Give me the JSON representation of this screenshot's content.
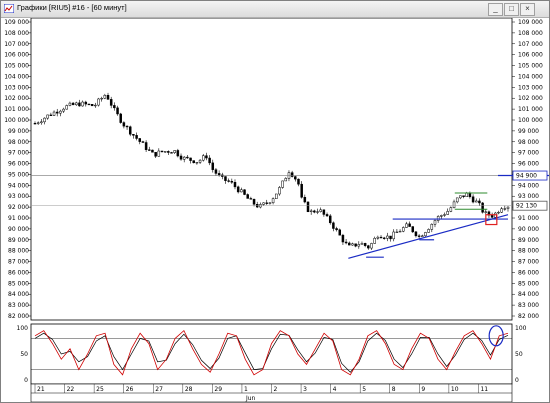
{
  "window": {
    "title": "Графики [RIU5] #16 - [60 минут]",
    "buttons": {
      "minimize": "_",
      "maximize": "□",
      "close": "×"
    }
  },
  "price_axis": {
    "left_labels": [
      "109 000",
      "108 000",
      "107 000",
      "106 000",
      "105 000",
      "104 000",
      "103 000",
      "102 000",
      "101 000",
      "100 000",
      "99 000",
      "98 000",
      "97 000",
      "96 000",
      "95 000",
      "94 000",
      "93 000",
      "92 000",
      "91 000",
      "90 000",
      "89 000",
      "88 000",
      "87 000",
      "86 000",
      "85 000",
      "84 000",
      "83 000",
      "82 000"
    ],
    "right_labels": [
      "109 000",
      "108 000",
      "107 000",
      "106 000",
      "105 000",
      "104 000",
      "103 000",
      "102 000",
      "101 000",
      "100 000",
      "99 000",
      "98 000",
      "97 000",
      "96 000",
      "95 000",
      "94 000",
      "93 000",
      "92 000",
      "91 000",
      "90 000",
      "89 000",
      "88 000",
      "87 000",
      "86 000",
      "85 000",
      "84 000",
      "83 000",
      "82 000"
    ],
    "marked_levels": [
      {
        "value": "94 900",
        "color": "#1a2bc4"
      },
      {
        "value": "92 130",
        "color": "#555555"
      }
    ]
  },
  "oscillator_axis": {
    "left_labels": [
      "100",
      "50",
      "0"
    ],
    "right_labels": [
      "100",
      "50",
      "0"
    ]
  },
  "time_axis": {
    "day_labels": [
      "21",
      "22",
      "25",
      "26",
      "27",
      "28",
      "29",
      "1",
      "2",
      "3",
      "4",
      "5",
      "8",
      "9",
      "10",
      "11"
    ],
    "month_label": "Jun"
  },
  "colors": {
    "candles": "#000000",
    "trendline": "#1a2bc4",
    "consolidation_box": "#2e8b2e",
    "highlight_box": "#e02020",
    "highlight_circle": "#1a2bc4",
    "stoch_fast": "#d00000",
    "stoch_slow": "#000000"
  },
  "chart_data": {
    "type": "candlestick",
    "instrument": "RIU5",
    "timeframe": "60 минут",
    "x_labels": [
      "21",
      "22",
      "25",
      "26",
      "27",
      "28",
      "29",
      "1",
      "2",
      "3",
      "4",
      "5",
      "8",
      "9",
      "10",
      "11"
    ],
    "y_range": [
      82000,
      109000
    ],
    "close_path": [
      [
        0,
        99700
      ],
      [
        0.5,
        100500
      ],
      [
        1,
        101200
      ],
      [
        1.5,
        101500
      ],
      [
        2,
        101300
      ],
      [
        2.4,
        102400
      ],
      [
        2.7,
        100800
      ],
      [
        3,
        99600
      ],
      [
        3.3,
        98700
      ],
      [
        3.7,
        97600
      ],
      [
        4,
        96800
      ],
      [
        4.3,
        97100
      ],
      [
        4.7,
        97200
      ],
      [
        5,
        96500
      ],
      [
        5.5,
        96200
      ],
      [
        5.8,
        96700
      ],
      [
        6,
        95500
      ],
      [
        6.3,
        94600
      ],
      [
        6.6,
        94300
      ],
      [
        7,
        93300
      ],
      [
        7.3,
        92500
      ],
      [
        7.6,
        92000
      ],
      [
        8,
        92700
      ],
      [
        8.3,
        93800
      ],
      [
        8.6,
        95400
      ],
      [
        8.9,
        94300
      ],
      [
        9,
        92800
      ],
      [
        9.3,
        91500
      ],
      [
        9.6,
        91800
      ],
      [
        10,
        90600
      ],
      [
        10.3,
        89400
      ],
      [
        10.6,
        88300
      ],
      [
        11,
        88700
      ],
      [
        11.3,
        88300
      ],
      [
        11.6,
        89500
      ],
      [
        12,
        89200
      ],
      [
        12.3,
        89800
      ],
      [
        12.6,
        90300
      ],
      [
        13,
        89300
      ],
      [
        13.3,
        90100
      ],
      [
        13.6,
        91000
      ],
      [
        14,
        91700
      ],
      [
        14.3,
        92800
      ],
      [
        14.6,
        93200
      ],
      [
        15,
        92300
      ],
      [
        15.2,
        91400
      ],
      [
        15.5,
        91200
      ],
      [
        15.8,
        92100
      ],
      [
        16,
        92130
      ]
    ],
    "annotations": {
      "horizontal_level": 94900,
      "current_price": 92130,
      "support_level": 90900
    },
    "oscillator": {
      "type": "stochastic",
      "range": [
        0,
        100
      ],
      "levels": [
        80,
        20
      ],
      "fast": [
        85,
        95,
        70,
        40,
        60,
        20,
        50,
        85,
        90,
        30,
        10,
        60,
        90,
        70,
        20,
        40,
        80,
        95,
        60,
        30,
        15,
        50,
        90,
        85,
        40,
        10,
        20,
        70,
        95,
        85,
        50,
        30,
        60,
        90,
        75,
        20,
        10,
        40,
        85,
        95,
        70,
        30,
        20,
        60,
        90,
        80,
        40,
        20,
        55,
        85,
        95,
        70,
        40,
        85,
        90
      ],
      "slow": [
        80,
        90,
        78,
        50,
        55,
        35,
        45,
        75,
        85,
        45,
        20,
        50,
        80,
        75,
        35,
        38,
        70,
        88,
        68,
        38,
        22,
        42,
        80,
        85,
        52,
        20,
        22,
        60,
        88,
        86,
        58,
        35,
        52,
        82,
        78,
        32,
        15,
        35,
        75,
        90,
        76,
        40,
        24,
        50,
        82,
        82,
        50,
        26,
        48,
        78,
        90,
        76,
        48,
        78,
        86
      ]
    }
  }
}
